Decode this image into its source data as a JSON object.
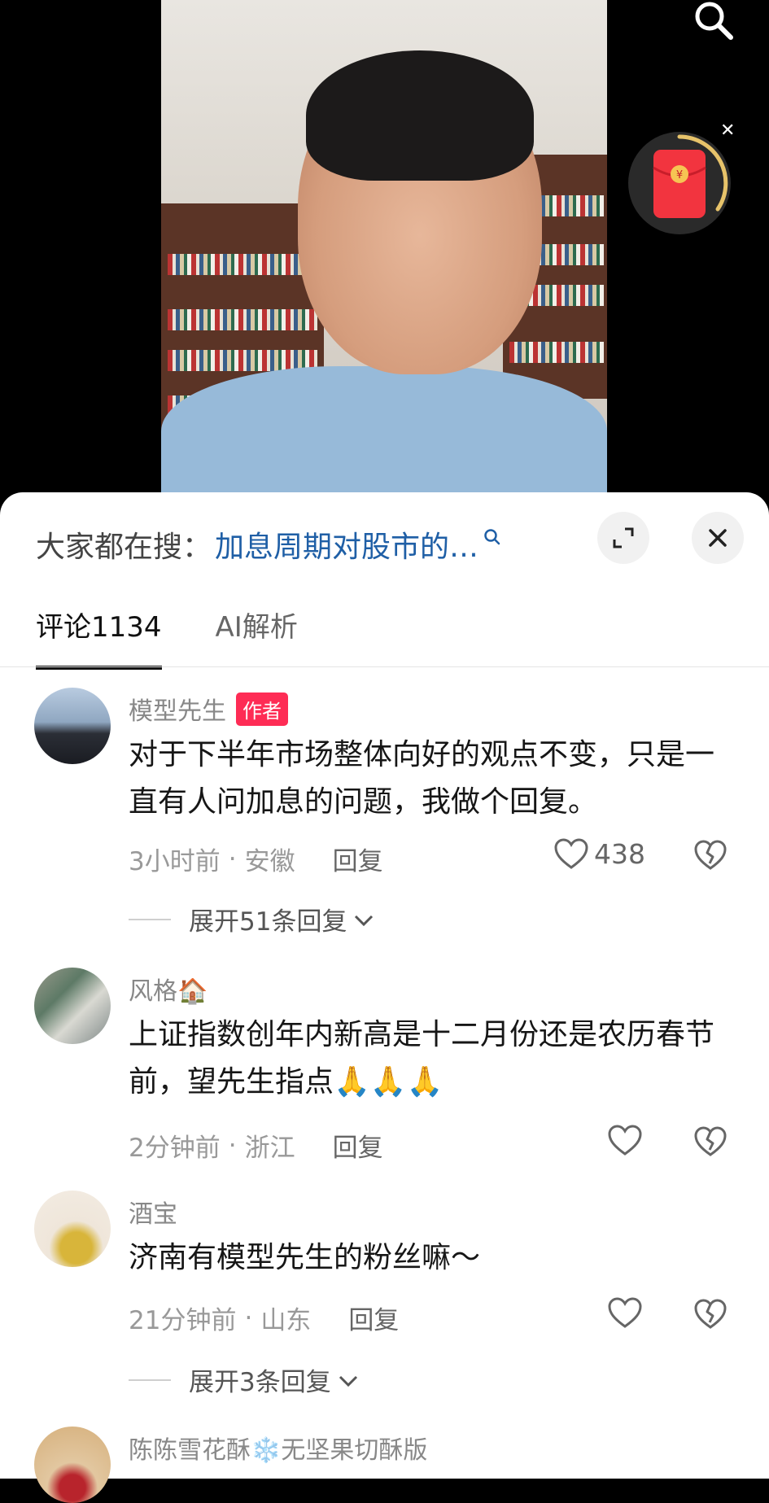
{
  "search_suggest": {
    "prefix": "大家都在搜：",
    "query": "加息周期对股市的…"
  },
  "tabs": [
    {
      "label": "评论1134",
      "active": true
    },
    {
      "label": "AI解析",
      "active": false
    }
  ],
  "comments": [
    {
      "username": "模型先生",
      "badge": "作者",
      "text": "对于下半年市场整体向好的观点不变，只是一直有人问加息的问题，我做个回复。",
      "time": "3小时前",
      "location": "安徽",
      "reply_label": "回复",
      "likes": "438",
      "expand_label": "展开51条回复"
    },
    {
      "username": "风格🏠",
      "text": "上证指数创年内新高是十二月份还是农历春节前，望先生指点🙏🙏🙏",
      "time": "2分钟前",
      "location": "浙江",
      "reply_label": "回复"
    },
    {
      "username": "酒宝",
      "text": "济南有模型先生的粉丝嘛～",
      "time": "21分钟前",
      "location": "山东",
      "reply_label": "回复",
      "expand_label": "展开3条回复"
    },
    {
      "username": "陈陈雪花酥❄️无坚果切酥版"
    }
  ],
  "icons": {
    "search": "search-icon",
    "red_packet": "red-packet-icon",
    "expand": "expand-icon",
    "close": "close-icon",
    "like": "heart-icon",
    "dislike": "broken-heart-icon",
    "chevron": "chevron-down-icon"
  },
  "colors": {
    "link_blue": "#1f5fa6",
    "badge_red": "#fe2c55",
    "packet_red": "#f2343f",
    "ring_gold": "#e7c36a"
  }
}
